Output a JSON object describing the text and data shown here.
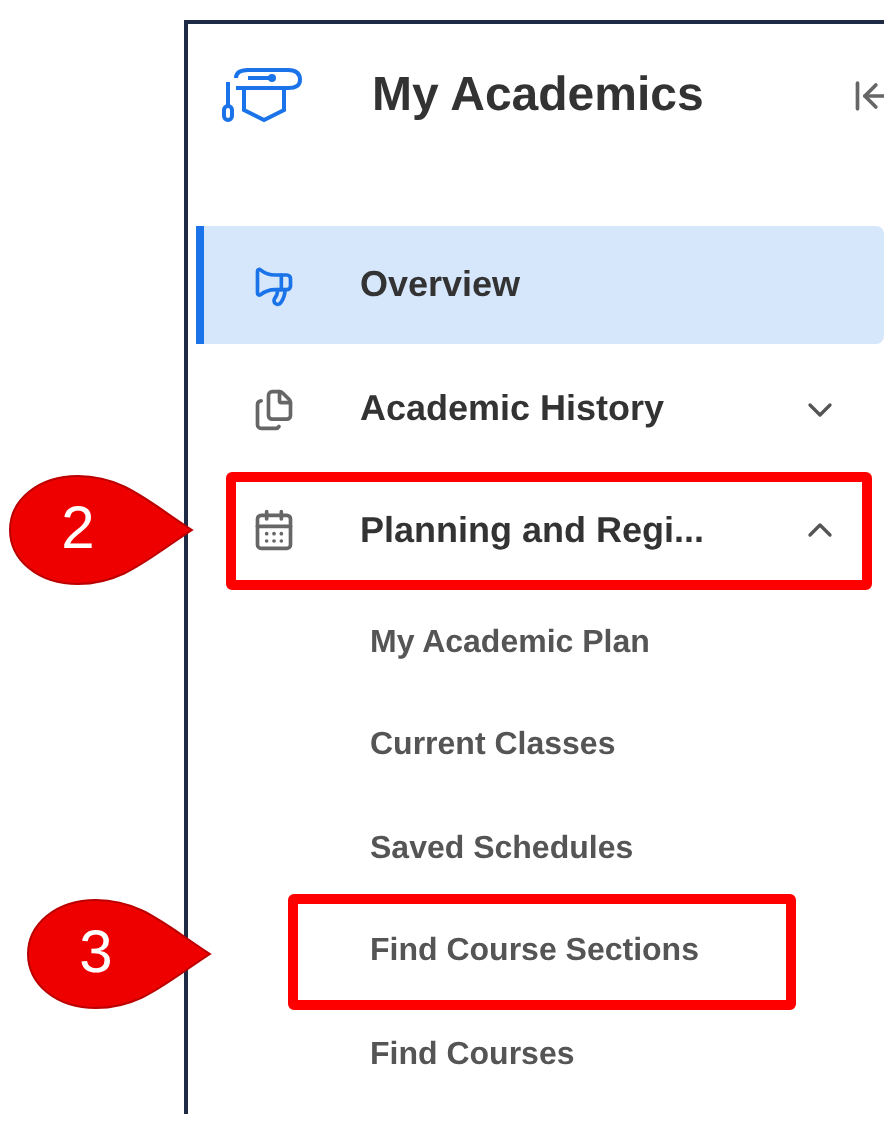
{
  "sidebar": {
    "title": "My Academics",
    "items": [
      {
        "label": "Overview",
        "selected": true
      },
      {
        "label": "Academic History",
        "selected": false,
        "expanded": false
      },
      {
        "label": "Planning and Regi...",
        "selected": false,
        "expanded": true,
        "callout": "2",
        "children": [
          {
            "label": "My Academic Plan"
          },
          {
            "label": "Current Classes"
          },
          {
            "label": "Saved Schedules"
          },
          {
            "label": "Find Course Sections",
            "callout": "3"
          },
          {
            "label": "Find Courses"
          }
        ]
      }
    ]
  }
}
